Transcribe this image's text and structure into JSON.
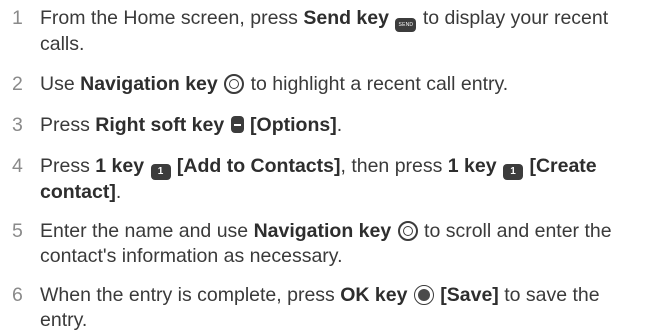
{
  "steps": [
    {
      "number": "1",
      "parts": {
        "a": "From the Home screen, press ",
        "b": "Send key",
        "icon": "SEND",
        "c": " to display your recent",
        "d": "calls."
      }
    },
    {
      "number": "2",
      "parts": {
        "a": "Use ",
        "b": "Navigation key",
        "c": " to highlight a recent call entry."
      }
    },
    {
      "number": "3",
      "parts": {
        "a": "Press ",
        "b": "Right soft key",
        "c": "[Options]",
        "d": "."
      }
    },
    {
      "number": "4",
      "parts": {
        "a": "Press ",
        "b": "1 key",
        "icon1": "1",
        "c": "[Add to Contacts]",
        "d": ", then press ",
        "e": "1 key",
        "icon2": "1",
        "f": "[Create",
        "g": "contact]",
        "h": "."
      }
    },
    {
      "number": "5",
      "parts": {
        "a": "Enter the name and use ",
        "b": "Navigation key",
        "c": " to scroll and enter the",
        "d": "contact's information as necessary."
      }
    },
    {
      "number": "6",
      "parts": {
        "a": "When the entry is complete, press ",
        "b": "OK key",
        "c": "[Save]",
        "d": " to save the",
        "e": "entry."
      }
    }
  ],
  "icons": {
    "send_key": "send-key-icon",
    "navigation_key": "navigation-key-icon",
    "right_soft_key": "right-soft-key-icon",
    "one_key": "one-key-icon",
    "ok_key": "ok-key-icon"
  }
}
